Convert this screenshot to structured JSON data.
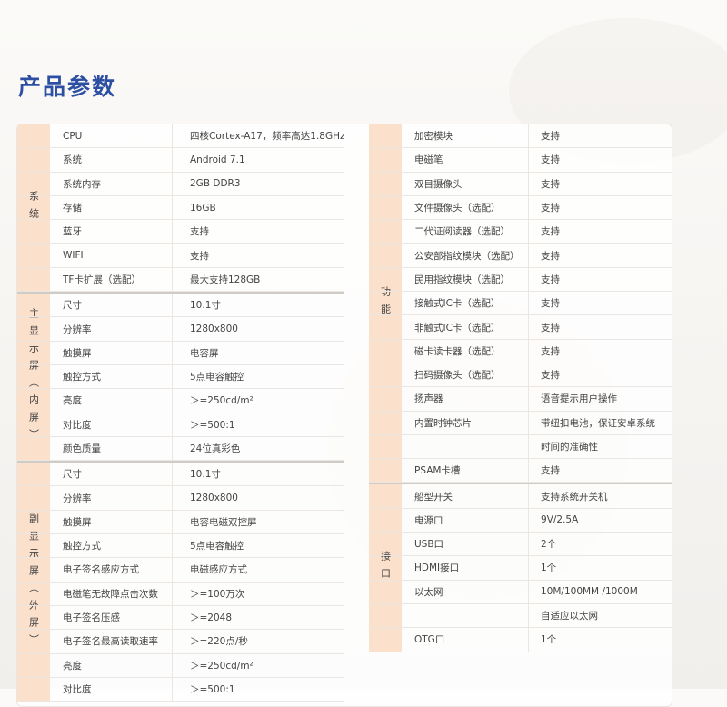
{
  "title": "产品参数",
  "colors": {
    "title": "#2c4fa3",
    "category_bg": "#fbe0cc"
  },
  "left": [
    {
      "category": "系统",
      "rows": [
        {
          "k": "CPU",
          "v": "四核Cortex-A17，频率高达1.8GHz"
        },
        {
          "k": "系统",
          "v": "Android 7.1"
        },
        {
          "k": "系统内存",
          "v": "2GB DDR3"
        },
        {
          "k": "存储",
          "v": "16GB"
        },
        {
          "k": "蓝牙",
          "v": "支持"
        },
        {
          "k": "WIFI",
          "v": "支持"
        },
        {
          "k": "TF卡扩展（选配）",
          "v": "最大支持128GB"
        }
      ]
    },
    {
      "category": "主显示屏（内屏）",
      "rows": [
        {
          "k": "尺寸",
          "v": "10.1寸"
        },
        {
          "k": "分辨率",
          "v": "1280x800"
        },
        {
          "k": "触摸屏",
          "v": "电容屏"
        },
        {
          "k": "触控方式",
          "v": "5点电容触控"
        },
        {
          "k": "亮度",
          "v": "＞=250cd/m²"
        },
        {
          "k": "对比度",
          "v": "＞=500:1"
        },
        {
          "k": "颜色质量",
          "v": "24位真彩色"
        }
      ]
    },
    {
      "category": "副显示屏（外屏）",
      "rows": [
        {
          "k": "尺寸",
          "v": "10.1寸"
        },
        {
          "k": "分辨率",
          "v": "1280x800"
        },
        {
          "k": "触摸屏",
          "v": "电容电磁双控屏"
        },
        {
          "k": "触控方式",
          "v": "5点电容触控"
        },
        {
          "k": "电子签名感应方式",
          "v": "电磁感应方式"
        },
        {
          "k": "电磁笔无故障点击次数",
          "v": "＞=100万次"
        },
        {
          "k": "电子签名压感",
          "v": "＞=2048"
        },
        {
          "k": "电子签名最高读取速率",
          "v": "＞=220点/秒"
        },
        {
          "k": "亮度",
          "v": "＞=250cd/m²"
        },
        {
          "k": "对比度",
          "v": "＞=500:1"
        }
      ]
    }
  ],
  "right": [
    {
      "category": "功能",
      "rows": [
        {
          "k": "加密模块",
          "v": "支持"
        },
        {
          "k": "电磁笔",
          "v": "支持"
        },
        {
          "k": "双目摄像头",
          "v": "支持"
        },
        {
          "k": "文件摄像头（选配）",
          "v": "支持"
        },
        {
          "k": "二代证阅读器（选配）",
          "v": "支持"
        },
        {
          "k": "公安部指纹模块（选配）",
          "v": "支持"
        },
        {
          "k": "民用指纹模块（选配）",
          "v": "支持"
        },
        {
          "k": "接触式IC卡（选配）",
          "v": "支持"
        },
        {
          "k": "非触式IC卡（选配）",
          "v": "支持"
        },
        {
          "k": "磁卡读卡器（选配）",
          "v": "支持"
        },
        {
          "k": "扫码摄像头（选配）",
          "v": "支持"
        },
        {
          "k": "扬声器",
          "v": "语音提示用户操作"
        },
        {
          "k": "内置时钟芯片",
          "v": "带纽扣电池，保证安卓系统"
        },
        {
          "k": "",
          "v": "时间的准确性"
        },
        {
          "k": "PSAM卡槽",
          "v": "支持"
        }
      ]
    },
    {
      "category": "接口",
      "rows": [
        {
          "k": "船型开关",
          "v": "支持系统开关机"
        },
        {
          "k": "电源口",
          "v": "9V/2.5A"
        },
        {
          "k": "USB口",
          "v": "2个"
        },
        {
          "k": "HDMI接口",
          "v": "1个"
        },
        {
          "k": "以太网",
          "v": "10M/100MM /1000M"
        },
        {
          "k": "",
          "v": "自适应以太网"
        },
        {
          "k": "OTG口",
          "v": "1个"
        }
      ]
    }
  ]
}
